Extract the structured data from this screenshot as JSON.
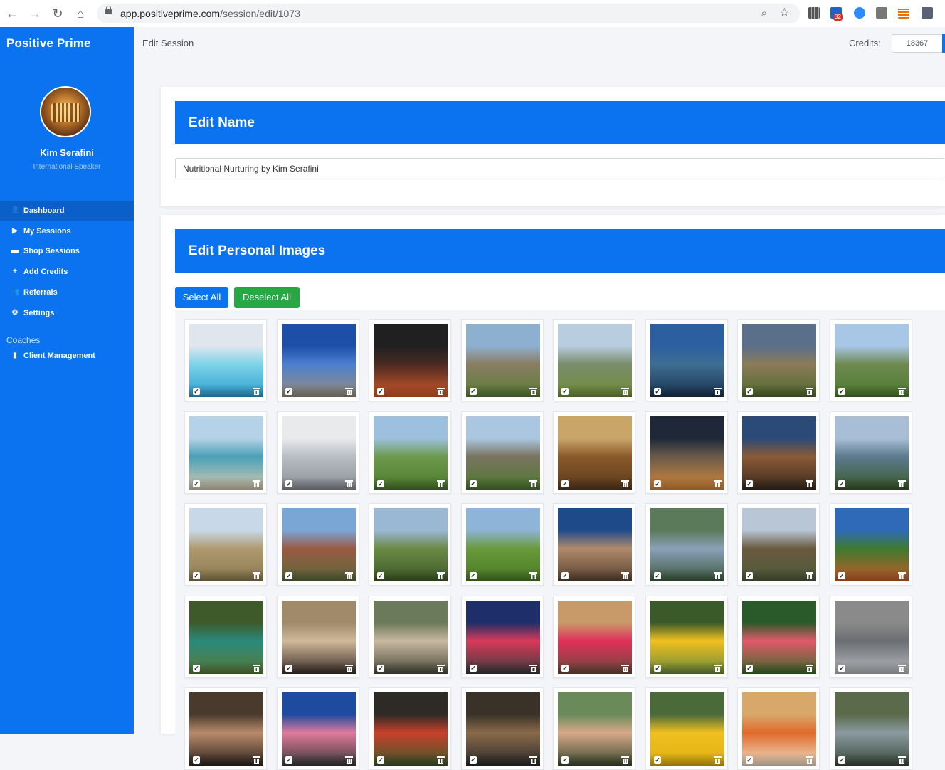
{
  "browser": {
    "url_host": "app.positiveprime.com",
    "url_path": "/session/edit/1073",
    "extension_badge": "32"
  },
  "sidebar": {
    "brand": "Positive Prime",
    "user_name": "Kim Serafini",
    "user_role": "International Speaker",
    "items": [
      {
        "label": "Dashboard",
        "icon": "user-icon",
        "glyph": "👤"
      },
      {
        "label": "My Sessions",
        "icon": "play-circle-icon",
        "glyph": "▶"
      },
      {
        "label": "Shop Sessions",
        "icon": "store-icon",
        "glyph": "▬"
      },
      {
        "label": "Add Credits",
        "icon": "plus-circle-icon",
        "glyph": "+"
      },
      {
        "label": "Referrals",
        "icon": "users-icon",
        "glyph": "👥"
      },
      {
        "label": "Settings",
        "icon": "gear-icon",
        "glyph": "⚙"
      }
    ],
    "coaches_label": "Coaches",
    "coach_items": [
      {
        "label": "Client Management",
        "icon": "id-card-icon",
        "glyph": "▮"
      }
    ]
  },
  "topbar": {
    "page_title": "Edit Session",
    "credits_label": "Credits:",
    "credits_value": "18367"
  },
  "edit_name": {
    "title": "Edit Name",
    "session_name": "Nutritional Nurturing by Kim Serafini"
  },
  "edit_images": {
    "title": "Edit Personal Images",
    "select_all": "Select All",
    "deselect_all": "Deselect All",
    "images": [
      {
        "subject": "hot spring lagoon",
        "colors": [
          "#dfe6ee",
          "#7fd3e8",
          "#2a9fd0"
        ]
      },
      {
        "subject": "LOVE sculpture by sea",
        "colors": [
          "#1d4fa8",
          "#4c7fd0",
          "#9a8d7a"
        ]
      },
      {
        "subject": "boat at night with lights",
        "colors": [
          "#202020",
          "#4a2a22",
          "#d85a2a"
        ]
      },
      {
        "subject": "stone manor and lane",
        "colors": [
          "#8eb0d0",
          "#8a7d62",
          "#5a7d36"
        ]
      },
      {
        "subject": "coastal terrace",
        "colors": [
          "#b8cde0",
          "#7a8c6a",
          "#6f8e3a"
        ]
      },
      {
        "subject": "lakeside houses at dusk",
        "colors": [
          "#2c5fa0",
          "#3e6e92",
          "#1a3250"
        ]
      },
      {
        "subject": "stone house at evening",
        "colors": [
          "#5a6f8a",
          "#8c7b5a",
          "#4e6a2c"
        ]
      },
      {
        "subject": "thatched cottage garden",
        "colors": [
          "#a8c6e6",
          "#6f8a52",
          "#4c7a2c"
        ]
      },
      {
        "subject": "sandy beach",
        "colors": [
          "#b6d2e8",
          "#4aa0b8",
          "#d8cbb0"
        ]
      },
      {
        "subject": "white living room",
        "colors": [
          "#e8eaec",
          "#b8bec4",
          "#8a8f96"
        ]
      },
      {
        "subject": "green countryside",
        "colors": [
          "#9cc0de",
          "#6e9a4e",
          "#4c7a2c"
        ]
      },
      {
        "subject": "stone tower house",
        "colors": [
          "#aac6e0",
          "#7a7460",
          "#4d7a30"
        ]
      },
      {
        "subject": "cosy sitting room",
        "colors": [
          "#c9a56a",
          "#8a5a2a",
          "#5a3a1e"
        ]
      },
      {
        "subject": "gazebo at night",
        "colors": [
          "#1e2838",
          "#6a5a4a",
          "#d88a3a"
        ]
      },
      {
        "subject": "wooden cabin deck",
        "colors": [
          "#2c4a78",
          "#8a5a36",
          "#3a2a1e"
        ]
      },
      {
        "subject": "bay view from hills",
        "colors": [
          "#a8bed6",
          "#5c7a8e",
          "#3a5a2a"
        ]
      },
      {
        "subject": "dunes and beach",
        "colors": [
          "#c8d8e8",
          "#b09a70",
          "#8a7a50"
        ]
      },
      {
        "subject": "red brick chateau",
        "colors": [
          "#7aa6d6",
          "#9a5a42",
          "#5a6a3a"
        ]
      },
      {
        "subject": "manor in woods",
        "colors": [
          "#9ab8d4",
          "#6a8a46",
          "#3e5a26"
        ]
      },
      {
        "subject": "golf green",
        "colors": [
          "#8eb4d8",
          "#6a9a3a",
          "#4a7a26"
        ]
      },
      {
        "subject": "modern stone house",
        "colors": [
          "#1e4a8a",
          "#b08a6a",
          "#5a4232"
        ]
      },
      {
        "subject": "man in garden path",
        "colors": [
          "#5a7a5a",
          "#8aa0b8",
          "#3e5a3e"
        ]
      },
      {
        "subject": "group at thatched hut",
        "colors": [
          "#b8c6d6",
          "#6a5a40",
          "#4e5a3a"
        ]
      },
      {
        "subject": "flowering shrubs",
        "colors": [
          "#2e6ab8",
          "#3e7a2e",
          "#c85a2a"
        ]
      },
      {
        "subject": "pool in jungle",
        "colors": [
          "#3e5a2a",
          "#2a8a7a",
          "#5a7a3a"
        ]
      },
      {
        "subject": "man with sunglasses",
        "colors": [
          "#a08a6a",
          "#d0b89a",
          "#3a2e28"
        ]
      },
      {
        "subject": "people at market",
        "colors": [
          "#6a7a5a",
          "#c8b8a0",
          "#4a4a3a"
        ]
      },
      {
        "subject": "couple with pink pig statue",
        "colors": [
          "#1e2e6a",
          "#d83a5a",
          "#3a3a3a"
        ]
      },
      {
        "subject": "pink bell",
        "colors": [
          "#c89a6a",
          "#e0305a",
          "#6a4a3a"
        ]
      },
      {
        "subject": "yellow flower",
        "colors": [
          "#3a5a2a",
          "#f0c020",
          "#6a8a3a"
        ]
      },
      {
        "subject": "pink flowers",
        "colors": [
          "#2a5a2a",
          "#e05a6a",
          "#3a6a2a"
        ]
      },
      {
        "subject": "outdoor pavilion",
        "colors": [
          "#8a8a8a",
          "#6a6e72",
          "#b8bcc0"
        ]
      },
      {
        "subject": "women at dinner",
        "colors": [
          "#4a3a2e",
          "#b88a6a",
          "#2e2420"
        ]
      },
      {
        "subject": "man with pink pig statue",
        "colors": [
          "#1e4aa0",
          "#e07a9a",
          "#3a3a3a"
        ]
      },
      {
        "subject": "flower arrangement",
        "colors": [
          "#2e2a26",
          "#c8402a",
          "#3e5a2a"
        ]
      },
      {
        "subject": "restaurant interior",
        "colors": [
          "#3a3228",
          "#8a6a4a",
          "#2a2a2a"
        ]
      },
      {
        "subject": "smiling man",
        "colors": [
          "#6a8a5a",
          "#d8a88a",
          "#3a4a2e"
        ]
      },
      {
        "subject": "yellow flowers close",
        "colors": [
          "#4a6a3a",
          "#f0c020",
          "#e0b010"
        ]
      },
      {
        "subject": "drinks on table",
        "colors": [
          "#d8a86a",
          "#e06a2a",
          "#f0e0c8"
        ]
      },
      {
        "subject": "cafe sign",
        "colors": [
          "#5a6a4a",
          "#8a9aa0",
          "#3a4a3a"
        ]
      }
    ]
  }
}
